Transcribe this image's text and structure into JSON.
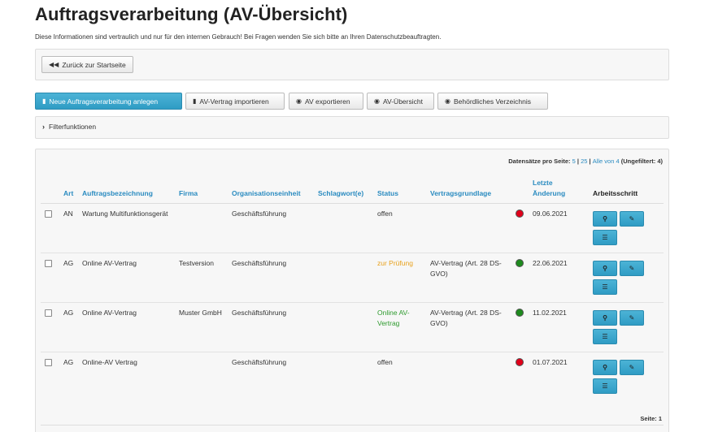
{
  "page": {
    "title": "Auftragsverarbeitung (AV-Übersicht)",
    "notice": "Diese Informationen sind vertraulich und nur für den internen Gebrauch! Bei Fragen wenden Sie sich bitte an Ihren Datenschutzbeauftragten."
  },
  "back_button": {
    "label": "Zurück zur Startseite",
    "icon": "backward-icon"
  },
  "toolbar": {
    "new_label": "Neue Auftragsverarbeitung anlegen",
    "import_label": "AV-Vertrag importieren",
    "export_label": "AV exportieren",
    "overview_label": "AV-Übersicht",
    "registry_label": "Behördliches Verzeichnis"
  },
  "filter": {
    "label": "Filterfunktionen"
  },
  "pager": {
    "prefix": "Datensätze pro Seite:",
    "opt5": "5",
    "sep1": " | ",
    "opt25": "25",
    "sep2": " | ",
    "all": "Alle von 4",
    "suffix": " (Ungefiltert: 4)",
    "pages": "Seite: 1"
  },
  "columns": {
    "art": "Art",
    "bezeichnung": "Auftragsbezeichnung",
    "firma": "Firma",
    "org": "Organisationseinheit",
    "schlagwort": "Schlagwort(e)",
    "status": "Status",
    "grundlage": "Vertragsgrundlage",
    "aenderung": "Letzte Änderung",
    "arbeitsschritt": "Arbeitsschritt"
  },
  "colors": {
    "link": "#2a8bc0",
    "status_red": "#e0001a",
    "status_green": "#1e8a1e",
    "status_orange": "#e8a11c",
    "status_green_text": "#2e9a2e",
    "button_blue": "#35a2c9"
  },
  "rows": [
    {
      "art": "AN",
      "bezeichnung": "Wartung Multifunktionsgerät",
      "firma": "",
      "org": "Geschäftsführung",
      "schlagwort": "",
      "status": "offen",
      "status_color": "#333333",
      "grundlage": "",
      "dot": "#e0001a",
      "datum": "09.06.2021"
    },
    {
      "art": "AG",
      "bezeichnung": "Online AV-Vertrag",
      "firma": "Testversion",
      "org": "Geschäftsführung",
      "schlagwort": "",
      "status": "zur Prüfung",
      "status_color": "#e8a11c",
      "grundlage": "AV-Vertrag (Art. 28 DS-GVO)",
      "dot": "#1e8a1e",
      "datum": "22.06.2021"
    },
    {
      "art": "AG",
      "bezeichnung": "Online AV-Vertrag",
      "firma": "Muster GmbH",
      "org": "Geschäftsführung",
      "schlagwort": "",
      "status": "Online AV-Vertrag",
      "status_color": "#2e9a2e",
      "grundlage": "AV-Vertrag (Art. 28 DS-GVO)",
      "dot": "#1e8a1e",
      "datum": "11.02.2021"
    },
    {
      "art": "AG",
      "bezeichnung": "Online-AV Vertrag",
      "firma": "",
      "org": "Geschäftsführung",
      "schlagwort": "",
      "status": "offen",
      "status_color": "#333333",
      "grundlage": "",
      "dot": "#e0001a",
      "datum": "01.07.2021"
    }
  ],
  "action_icons": {
    "view": "search-icon",
    "edit": "pencil-icon",
    "list": "list-icon"
  }
}
